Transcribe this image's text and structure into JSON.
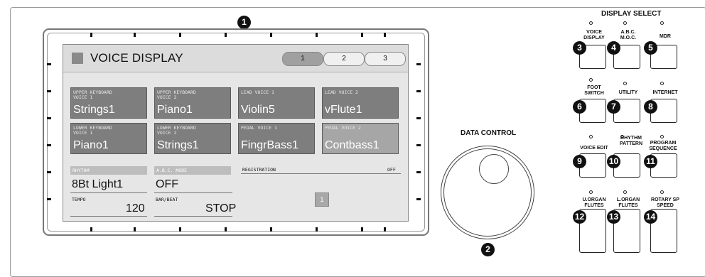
{
  "display": {
    "title": "VOICE DISPLAY",
    "pages": [
      "1",
      "2",
      "3"
    ],
    "voices": [
      {
        "label": "UPPER KEYBOARD\nVOICE 1",
        "name": "Strings1"
      },
      {
        "label": "UPPER KEYBOARD\nVOICE 2",
        "name": "Piano1"
      },
      {
        "label": "LEAD VOICE 1",
        "name": "Violin5"
      },
      {
        "label": "LEAD VOICE 2",
        "name": "vFlute1"
      },
      {
        "label": "LOWER KEYBOARD\nVOICE 1",
        "name": "Piano1"
      },
      {
        "label": "LOWER KEYBOARD\nVOICE 2",
        "name": "Strings1"
      },
      {
        "label": "PEDAL VOICE 1",
        "name": "FingrBass1"
      },
      {
        "label": "PEDAL VOICE 2",
        "name": "Contbass1"
      }
    ],
    "rhythm_label": "RHYTHM",
    "rhythm_value": "8Bt Light1",
    "abc_label": "A.B.C. MODE",
    "abc_value": "OFF",
    "registration_label": "REGISTRATION",
    "registration_state": "OFF",
    "registration_value": "1",
    "tempo_label": "TEMPO",
    "tempo_value": "120",
    "barbeat_label": "BAR/BEAT",
    "barbeat_value": "STOP"
  },
  "data_control": {
    "label": "DATA CONTROL"
  },
  "display_select": {
    "title": "DISPLAY SELECT",
    "buttons": [
      {
        "label": "VOICE\nDISPLAY"
      },
      {
        "label": "A.B.C.\nM.O.C."
      },
      {
        "label": "MDR"
      },
      {
        "label": "FOOT\nSWITCH"
      },
      {
        "label": "UTILITY"
      },
      {
        "label": "INTERNET"
      },
      {
        "label": "VOICE EDIT"
      },
      {
        "label": "RHYTHM\nPATTERN"
      },
      {
        "label": "PROGRAM\nSEQUENCE"
      },
      {
        "label": "U.ORGAN\nFLUTES"
      },
      {
        "label": "L.ORGAN\nFLUTES"
      },
      {
        "label": "ROTARY SP\nSPEED"
      }
    ]
  },
  "callouts": [
    "1",
    "2",
    "3",
    "4",
    "5",
    "6",
    "7",
    "8",
    "9",
    "10",
    "11",
    "12",
    "13",
    "14"
  ]
}
